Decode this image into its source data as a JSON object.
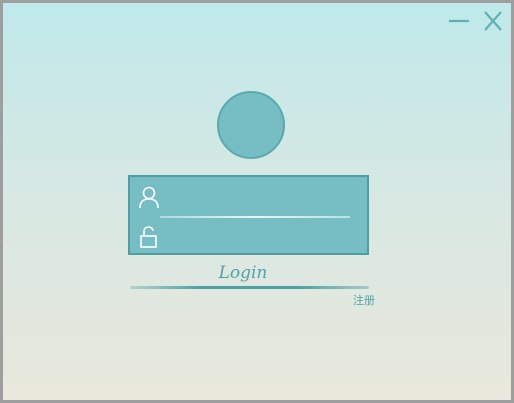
{
  "window": {
    "minimize_icon": "minus-icon",
    "close_icon": "close-icon"
  },
  "avatar": {
    "icon": "avatar-circle"
  },
  "form": {
    "username": {
      "icon": "user-icon",
      "value": "",
      "placeholder": ""
    },
    "password": {
      "icon": "unlock-icon",
      "value": "",
      "placeholder": ""
    }
  },
  "login": {
    "label": "Login"
  },
  "register": {
    "label": "注册"
  },
  "colors": {
    "accent": "#76bec3",
    "accent_dark": "#4e9ea4",
    "text_accent": "#4ea2a8",
    "bg_top": "#bfe9ea",
    "bg_bottom": "#e9e8dc"
  }
}
